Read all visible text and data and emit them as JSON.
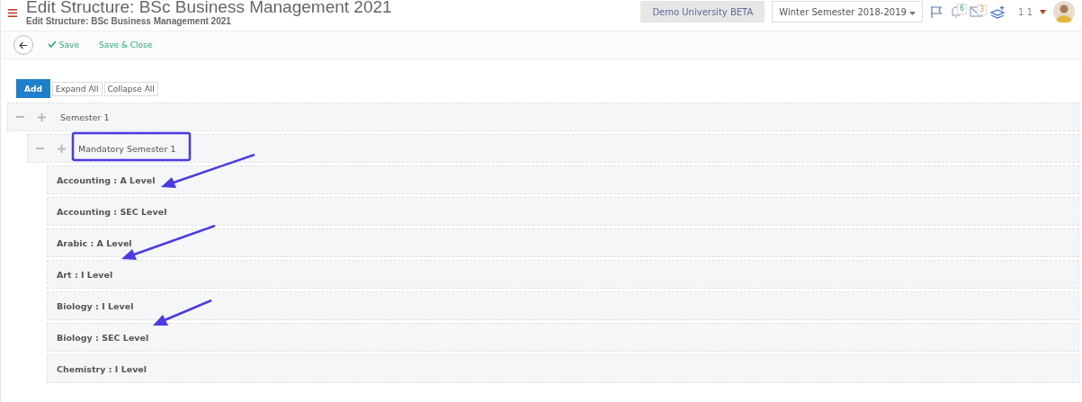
{
  "header": {
    "title": "Edit Structure: BSc Business Management 2021",
    "subtitle": "Edit Structure: BSc Business Management 2021",
    "institution": "Demo University BETA",
    "semester": "Winter Semester 2018-2019",
    "notifications": "6",
    "messages": "3",
    "user_count": "1 1"
  },
  "toolbar": {
    "save": "Save",
    "save_close": "Save & Close"
  },
  "actions": {
    "add": "Add",
    "expand_all": "Expand All",
    "collapse_all": "Collapse All"
  },
  "tree": [
    {
      "label": "Semester 1",
      "children": [
        {
          "label": "Mandatory Semester 1",
          "children": [
            {
              "label": "Accounting : A Level"
            },
            {
              "label": "Accounting : SEC Level"
            },
            {
              "label": "Arabic : A Level"
            },
            {
              "label": "Art : I Level"
            },
            {
              "label": "Biology : I Level"
            },
            {
              "label": "Biology : SEC Level"
            },
            {
              "label": "Chemistry : I Level"
            }
          ]
        }
      ]
    }
  ]
}
